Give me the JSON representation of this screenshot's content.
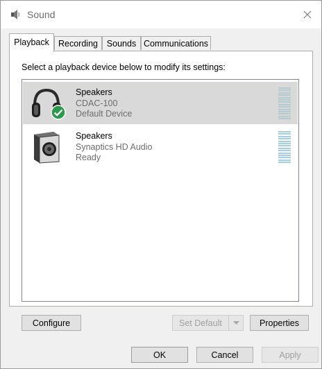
{
  "window": {
    "title": "Sound",
    "title_icon": "speaker-icon",
    "close_icon": "close-icon"
  },
  "tabs": [
    {
      "label": "Playback",
      "active": true
    },
    {
      "label": "Recording",
      "active": false
    },
    {
      "label": "Sounds",
      "active": false
    },
    {
      "label": "Communications",
      "active": false
    }
  ],
  "playback": {
    "instruction": "Select a playback device below to modify its settings:",
    "devices": [
      {
        "name": "Speakers",
        "description": "CDAC-100",
        "status": "Default Device",
        "icon": "headphones-icon",
        "badge_icon": "default-check-icon",
        "selected": true
      },
      {
        "name": "Speakers",
        "description": "Synaptics HD Audio",
        "status": "Ready",
        "icon": "speaker-box-icon",
        "selected": false
      }
    ]
  },
  "buttons": {
    "configure": "Configure",
    "set_default": "Set Default",
    "properties": "Properties",
    "ok": "OK",
    "cancel": "Cancel",
    "apply": "Apply"
  },
  "colors": {
    "selected_row": "#d9d9d9",
    "check_badge": "#2b9a4c",
    "level_meter": "#a3cfe0"
  }
}
